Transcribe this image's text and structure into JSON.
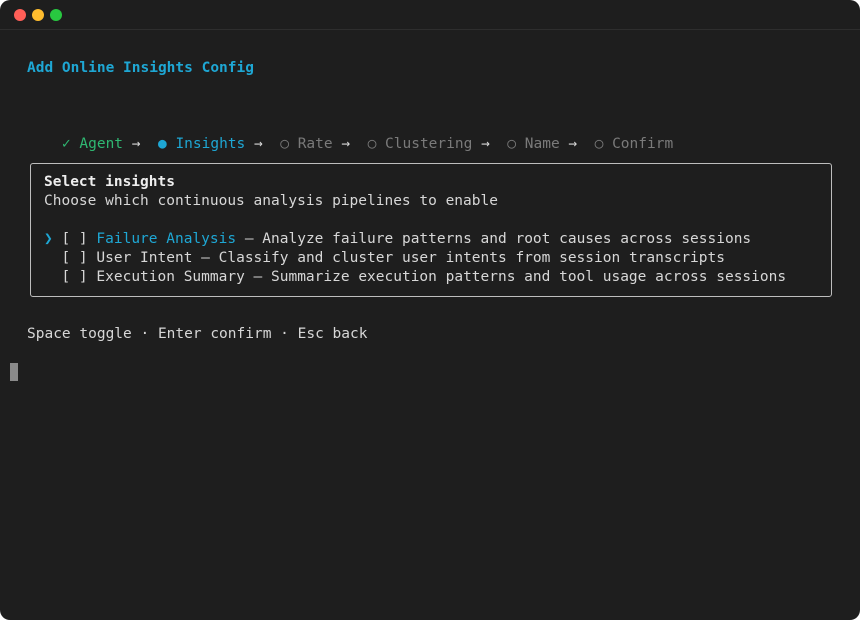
{
  "window": {
    "controls": [
      "close",
      "minimize",
      "zoom"
    ]
  },
  "header": {
    "title": "Add Online Insights Config"
  },
  "wizard": {
    "steps": [
      {
        "marker": "✓",
        "label": "Agent",
        "state": "done"
      },
      {
        "marker": "●",
        "label": "Insights",
        "state": "active"
      },
      {
        "marker": "○",
        "label": "Rate",
        "state": "pending"
      },
      {
        "marker": "○",
        "label": "Clustering",
        "state": "pending"
      },
      {
        "marker": "○",
        "label": "Name",
        "state": "pending"
      },
      {
        "marker": "○",
        "label": "Confirm",
        "state": "pending"
      }
    ],
    "separator": "→"
  },
  "panel": {
    "title": "Select insights",
    "subtitle": "Choose which continuous analysis pipelines to enable",
    "pointer": "❯",
    "options": [
      {
        "checkbox": "[ ]",
        "name": "Failure Analysis",
        "dash": "—",
        "description": "Analyze failure patterns and root causes across sessions",
        "focused": true,
        "checked": false
      },
      {
        "checkbox": "[ ]",
        "name": "User Intent",
        "dash": "—",
        "description": "Classify and cluster user intents from session transcripts",
        "focused": false,
        "checked": false
      },
      {
        "checkbox": "[ ]",
        "name": "Execution Summary",
        "dash": "—",
        "description": "Summarize execution patterns and tool usage across sessions",
        "focused": false,
        "checked": false
      }
    ]
  },
  "footer": {
    "hint": "Space toggle · Enter confirm · Esc back"
  },
  "colors": {
    "background": "#1e1e1e",
    "accent": "#1ea7d4",
    "done": "#2fb872",
    "pending": "#7a7a7a",
    "text": "#d7d7d7",
    "border": "#bdbdbd"
  }
}
